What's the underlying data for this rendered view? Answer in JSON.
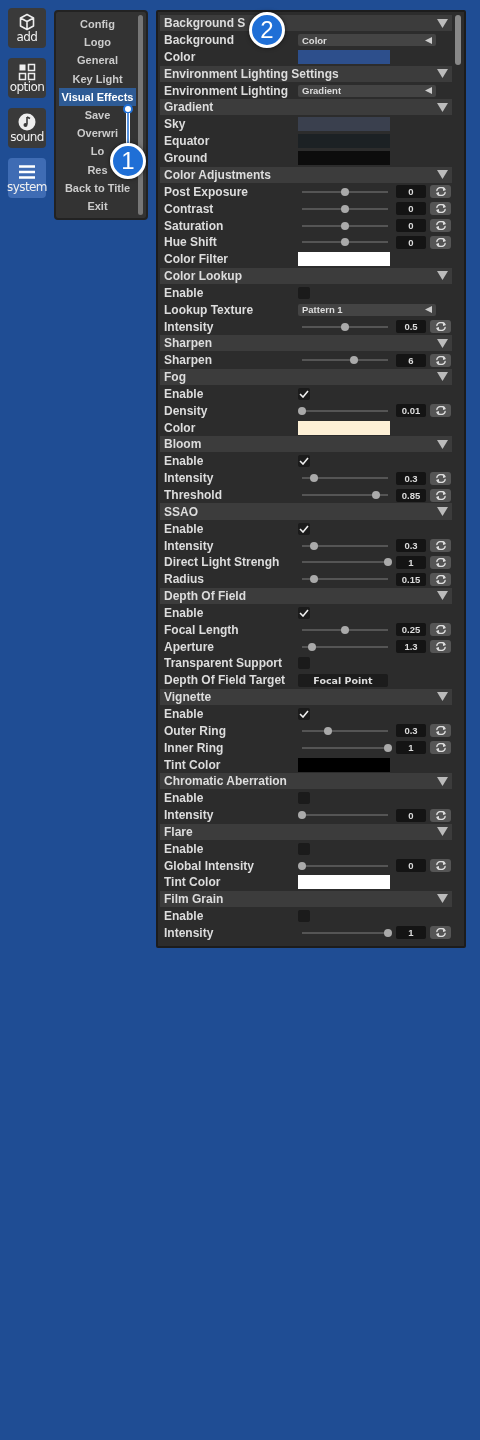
{
  "sidebar": [
    {
      "label": "add",
      "selected": false
    },
    {
      "label": "option",
      "selected": false
    },
    {
      "label": "sound",
      "selected": false
    },
    {
      "label": "system",
      "selected": true
    }
  ],
  "menu": [
    {
      "label": "Config",
      "selected": false
    },
    {
      "label": "Logo",
      "selected": false
    },
    {
      "label": "General",
      "selected": false
    },
    {
      "label": "Key Light",
      "selected": false
    },
    {
      "label": "Visual Effects",
      "selected": true
    },
    {
      "label": "Save",
      "selected": false
    },
    {
      "label": "Overwri",
      "selected": false
    },
    {
      "label": "Lo",
      "selected": false
    },
    {
      "label": "Res",
      "selected": false
    },
    {
      "label": "Back to Title",
      "selected": false
    },
    {
      "label": "Exit",
      "selected": false
    }
  ],
  "sections": [
    {
      "title": "Background S",
      "items": [
        {
          "kind": "dropdown",
          "label": "Background",
          "value": "Color"
        },
        {
          "kind": "color",
          "label": "Color",
          "color": "#2d4f8c"
        }
      ]
    },
    {
      "title": "Environment Lighting Settings",
      "items": [
        {
          "kind": "dropdown",
          "label": "Environment Lighting",
          "value": "Gradient"
        }
      ]
    },
    {
      "title": "Gradient",
      "items": [
        {
          "kind": "color",
          "label": "Sky",
          "color": "#3a404e"
        },
        {
          "kind": "color",
          "label": "Equator",
          "color": "#1c2124"
        },
        {
          "kind": "color",
          "label": "Ground",
          "color": "#0c0c0c"
        }
      ]
    },
    {
      "title": "Color Adjustments",
      "items": [
        {
          "kind": "slider",
          "label": "Post Exposure",
          "level": 0.5,
          "value": "0"
        },
        {
          "kind": "slider",
          "label": "Contrast",
          "level": 0.5,
          "value": "0"
        },
        {
          "kind": "slider",
          "label": "Saturation",
          "level": 0.5,
          "value": "0"
        },
        {
          "kind": "slider",
          "label": "Hue Shift",
          "level": 0.5,
          "value": "0"
        },
        {
          "kind": "color",
          "label": "Color Filter",
          "color": "#ffffff"
        }
      ]
    },
    {
      "title": "Color Lookup",
      "items": [
        {
          "kind": "checkbox",
          "label": "Enable",
          "checked": false
        },
        {
          "kind": "dropdown",
          "label": "Lookup Texture",
          "value": "Pattern 1"
        },
        {
          "kind": "slider",
          "label": "Intensity",
          "level": 0.5,
          "value": "0.5"
        }
      ]
    },
    {
      "title": "Sharpen",
      "items": [
        {
          "kind": "slider",
          "label": "Sharpen",
          "level": 0.6,
          "value": "6"
        }
      ]
    },
    {
      "title": "Fog",
      "items": [
        {
          "kind": "checkbox",
          "label": "Enable",
          "checked": true
        },
        {
          "kind": "slider",
          "label": "Density",
          "level": 0,
          "value": "0.01"
        },
        {
          "kind": "color",
          "label": "Color",
          "color": "#fdf0d6"
        }
      ]
    },
    {
      "title": "Bloom",
      "items": [
        {
          "kind": "checkbox",
          "label": "Enable",
          "checked": true
        },
        {
          "kind": "slider",
          "label": "Intensity",
          "level": 0.14,
          "value": "0.3"
        },
        {
          "kind": "slider",
          "label": "Threshold",
          "level": 0.86,
          "value": "0.85"
        }
      ]
    },
    {
      "title": "SSAO",
      "items": [
        {
          "kind": "checkbox",
          "label": "Enable",
          "checked": true
        },
        {
          "kind": "slider",
          "label": "Intensity",
          "level": 0.14,
          "value": "0.3"
        },
        {
          "kind": "slider",
          "label": "Direct Light Strengh",
          "level": 1,
          "value": "1"
        },
        {
          "kind": "slider",
          "label": "Radius",
          "level": 0.14,
          "value": "0.15"
        }
      ]
    },
    {
      "title": "Depth Of Field",
      "items": [
        {
          "kind": "checkbox",
          "label": "Enable",
          "checked": true
        },
        {
          "kind": "slider",
          "label": "Focal Length",
          "level": 0.5,
          "value": "0.25"
        },
        {
          "kind": "slider",
          "label": "Aperture",
          "level": 0.12,
          "value": "1.3"
        },
        {
          "kind": "checkbox",
          "label": "Transparent Support",
          "checked": false
        },
        {
          "kind": "button",
          "label": "Depth Of Field Target",
          "value": "Focal Point"
        }
      ]
    },
    {
      "title": "Vignette",
      "items": [
        {
          "kind": "checkbox",
          "label": "Enable",
          "checked": true
        },
        {
          "kind": "slider",
          "label": "Outer Ring",
          "level": 0.3,
          "value": "0.3"
        },
        {
          "kind": "slider",
          "label": "Inner Ring",
          "level": 1,
          "value": "1"
        },
        {
          "kind": "color",
          "label": "Tint Color",
          "color": "#000000"
        }
      ]
    },
    {
      "title": "Chromatic Aberration",
      "items": [
        {
          "kind": "checkbox",
          "label": "Enable",
          "checked": false
        },
        {
          "kind": "slider",
          "label": "Intensity",
          "level": 0,
          "value": "0"
        }
      ]
    },
    {
      "title": "Flare",
      "items": [
        {
          "kind": "checkbox",
          "label": "Enable",
          "checked": false
        },
        {
          "kind": "slider",
          "label": "Global Intensity",
          "level": 0,
          "value": "0"
        },
        {
          "kind": "color",
          "label": "Tint Color",
          "color": "#ffffff"
        }
      ]
    },
    {
      "title": "Film Grain",
      "items": [
        {
          "kind": "checkbox",
          "label": "Enable",
          "checked": false
        },
        {
          "kind": "slider",
          "label": "Intensity",
          "level": 1,
          "value": "1"
        }
      ]
    }
  ],
  "callouts": [
    {
      "label": "1"
    },
    {
      "label": "2"
    }
  ]
}
